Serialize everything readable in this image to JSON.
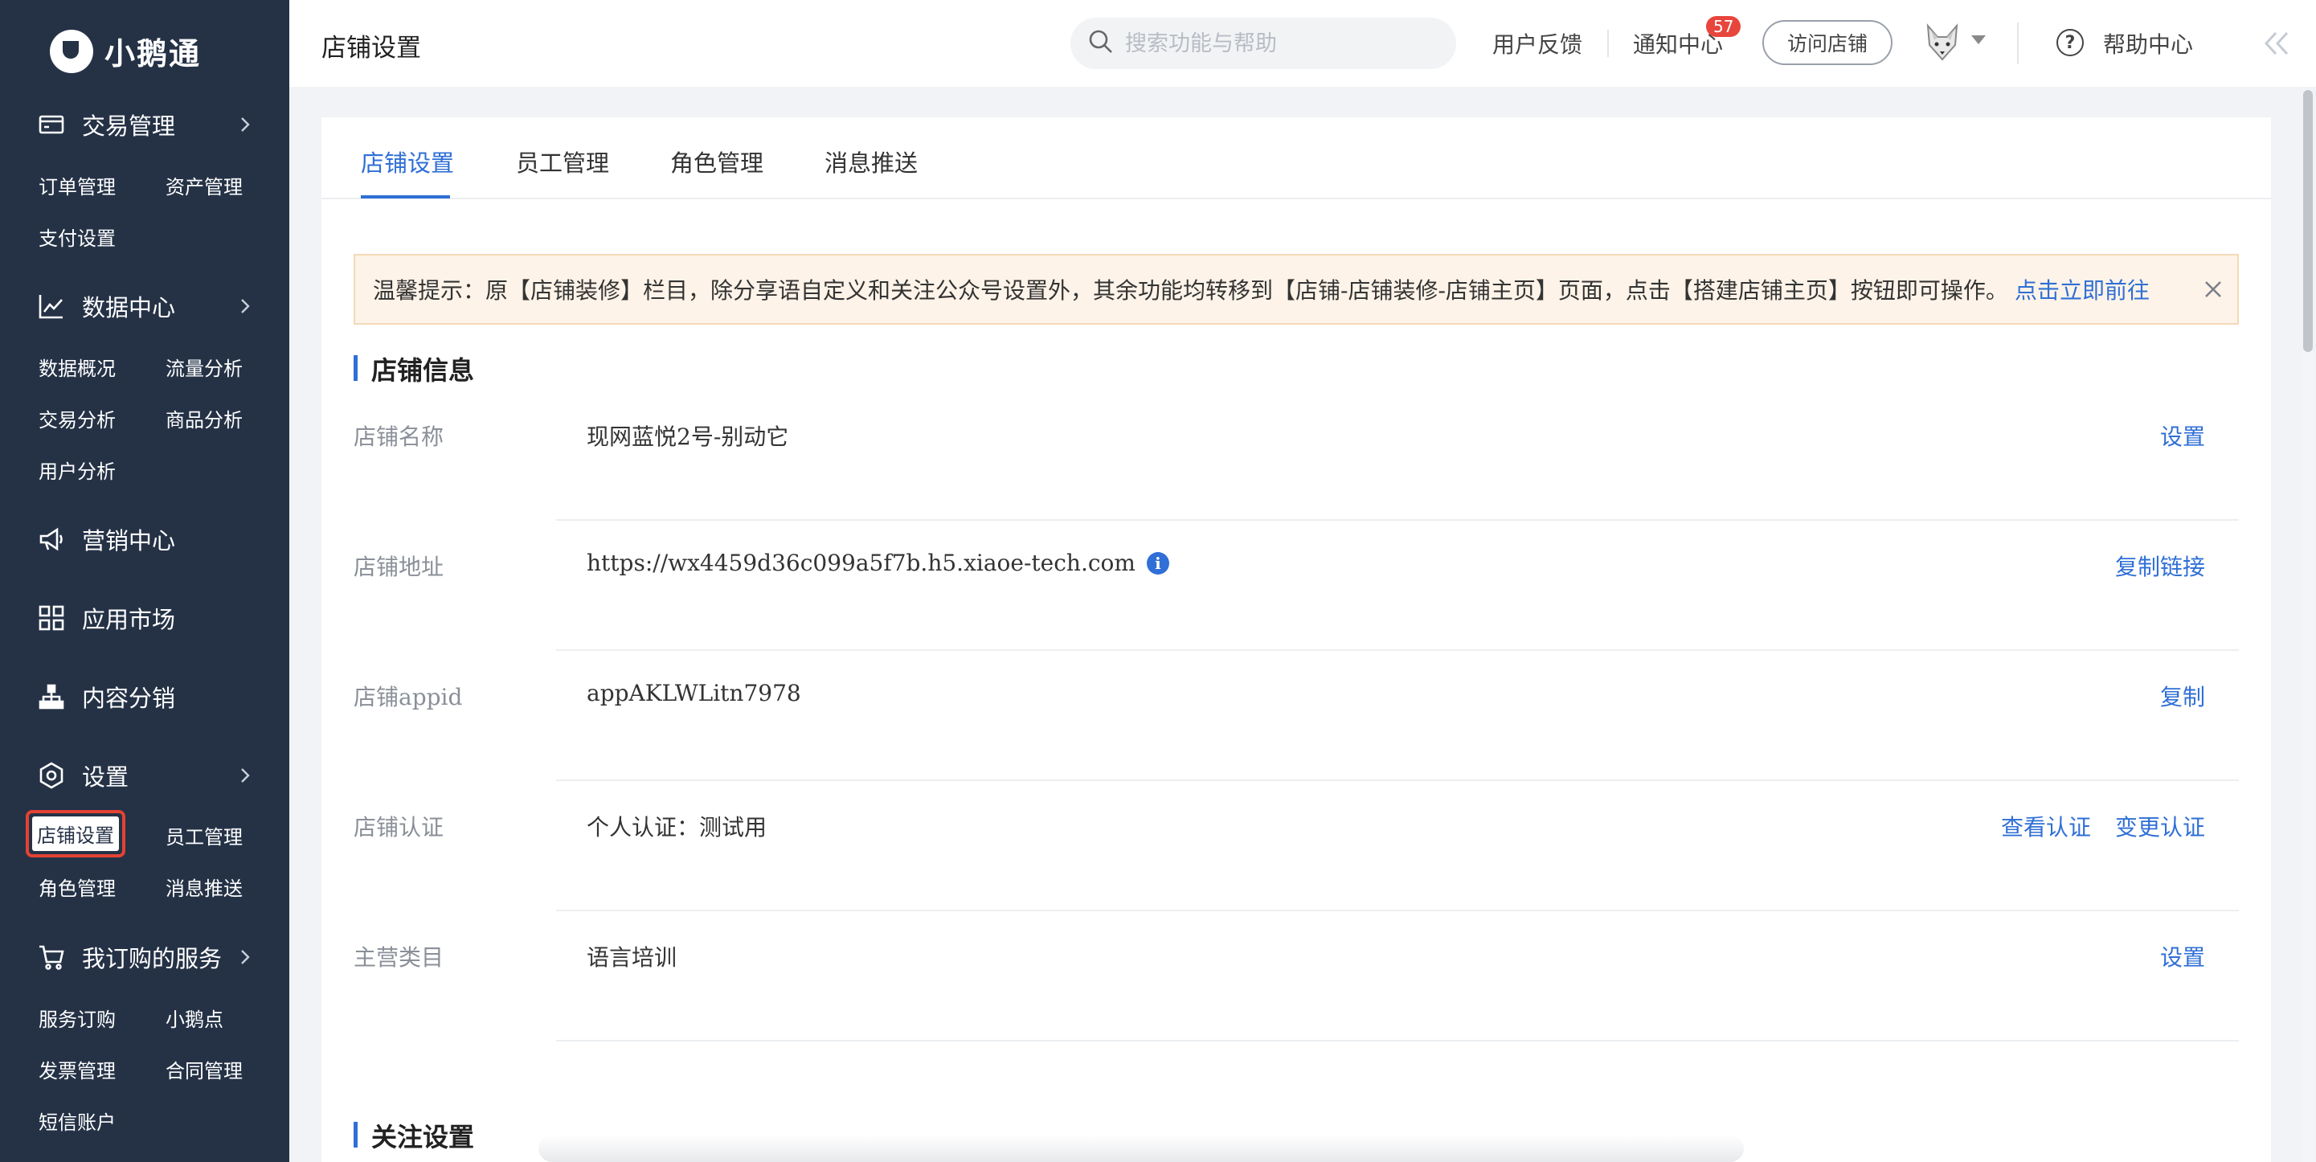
{
  "app": {
    "brand": "小鹅通"
  },
  "sidebar": {
    "sections": [
      {
        "label": "交易管理",
        "icon": "wallet-icon",
        "has_arrow": true,
        "items": [
          "订单管理",
          "资产管理",
          "支付设置"
        ]
      },
      {
        "label": "数据中心",
        "icon": "chart-line-icon",
        "has_arrow": true,
        "items": [
          "数据概况",
          "流量分析",
          "交易分析",
          "商品分析",
          "用户分析"
        ]
      },
      {
        "label": "营销中心",
        "icon": "megaphone-icon",
        "has_arrow": false,
        "items": []
      },
      {
        "label": "应用市场",
        "icon": "grid-apps-icon",
        "has_arrow": false,
        "items": []
      },
      {
        "label": "内容分销",
        "icon": "share-tree-icon",
        "has_arrow": false,
        "items": []
      },
      {
        "label": "设置",
        "icon": "gear-hex-icon",
        "has_arrow": true,
        "items": [
          "店铺设置",
          "员工管理",
          "角色管理",
          "消息推送"
        ]
      },
      {
        "label": "我订购的服务",
        "icon": "cart-icon",
        "has_arrow": true,
        "items": [
          "服务订购",
          "小鹅点",
          "发票管理",
          "合同管理",
          "短信账户"
        ]
      }
    ],
    "active_item": "店铺设置"
  },
  "header": {
    "title": "店铺设置",
    "search_placeholder": "搜索功能与帮助",
    "feedback": "用户反馈",
    "notifications": "通知中心",
    "notification_count": "57",
    "visit_store": "访问店铺",
    "help_center": "帮助中心"
  },
  "tabs": [
    {
      "label": "店铺设置",
      "active": true
    },
    {
      "label": "员工管理",
      "active": false
    },
    {
      "label": "角色管理",
      "active": false
    },
    {
      "label": "消息推送",
      "active": false
    }
  ],
  "notice": {
    "text": "温馨提示：原【店铺装修】栏目，除分享语自定义和关注公众号设置外，其余功能均转移到【店铺-店铺装修-店铺主页】页面，点击【搭建店铺主页】按钮即可操作。",
    "link": "点击立即前往"
  },
  "store_info": {
    "title": "店铺信息",
    "rows": [
      {
        "label": "店铺名称",
        "value": "现网蓝悦2号-别动它",
        "actions": [
          "设置"
        ]
      },
      {
        "label": "店铺地址",
        "value": "https://wx4459d36c099a5f7b.h5.xiaoe-tech.com",
        "info": "i",
        "actions": [
          "复制链接"
        ]
      },
      {
        "label": "店铺appid",
        "value": "appAKLWLitn7978",
        "actions": [
          "复制"
        ]
      },
      {
        "label": "店铺认证",
        "value": "个人认证：测试用",
        "actions": [
          "查看认证",
          "变更认证"
        ]
      },
      {
        "label": "主营类目",
        "value": "语言培训",
        "actions": [
          "设置"
        ]
      }
    ]
  },
  "follow_settings": {
    "title": "关注设置"
  },
  "colors": {
    "sidebar_bg": "#253246",
    "accent": "#2f6fd6",
    "badge": "#e8453c",
    "notice_bg": "#fdf3e8"
  }
}
